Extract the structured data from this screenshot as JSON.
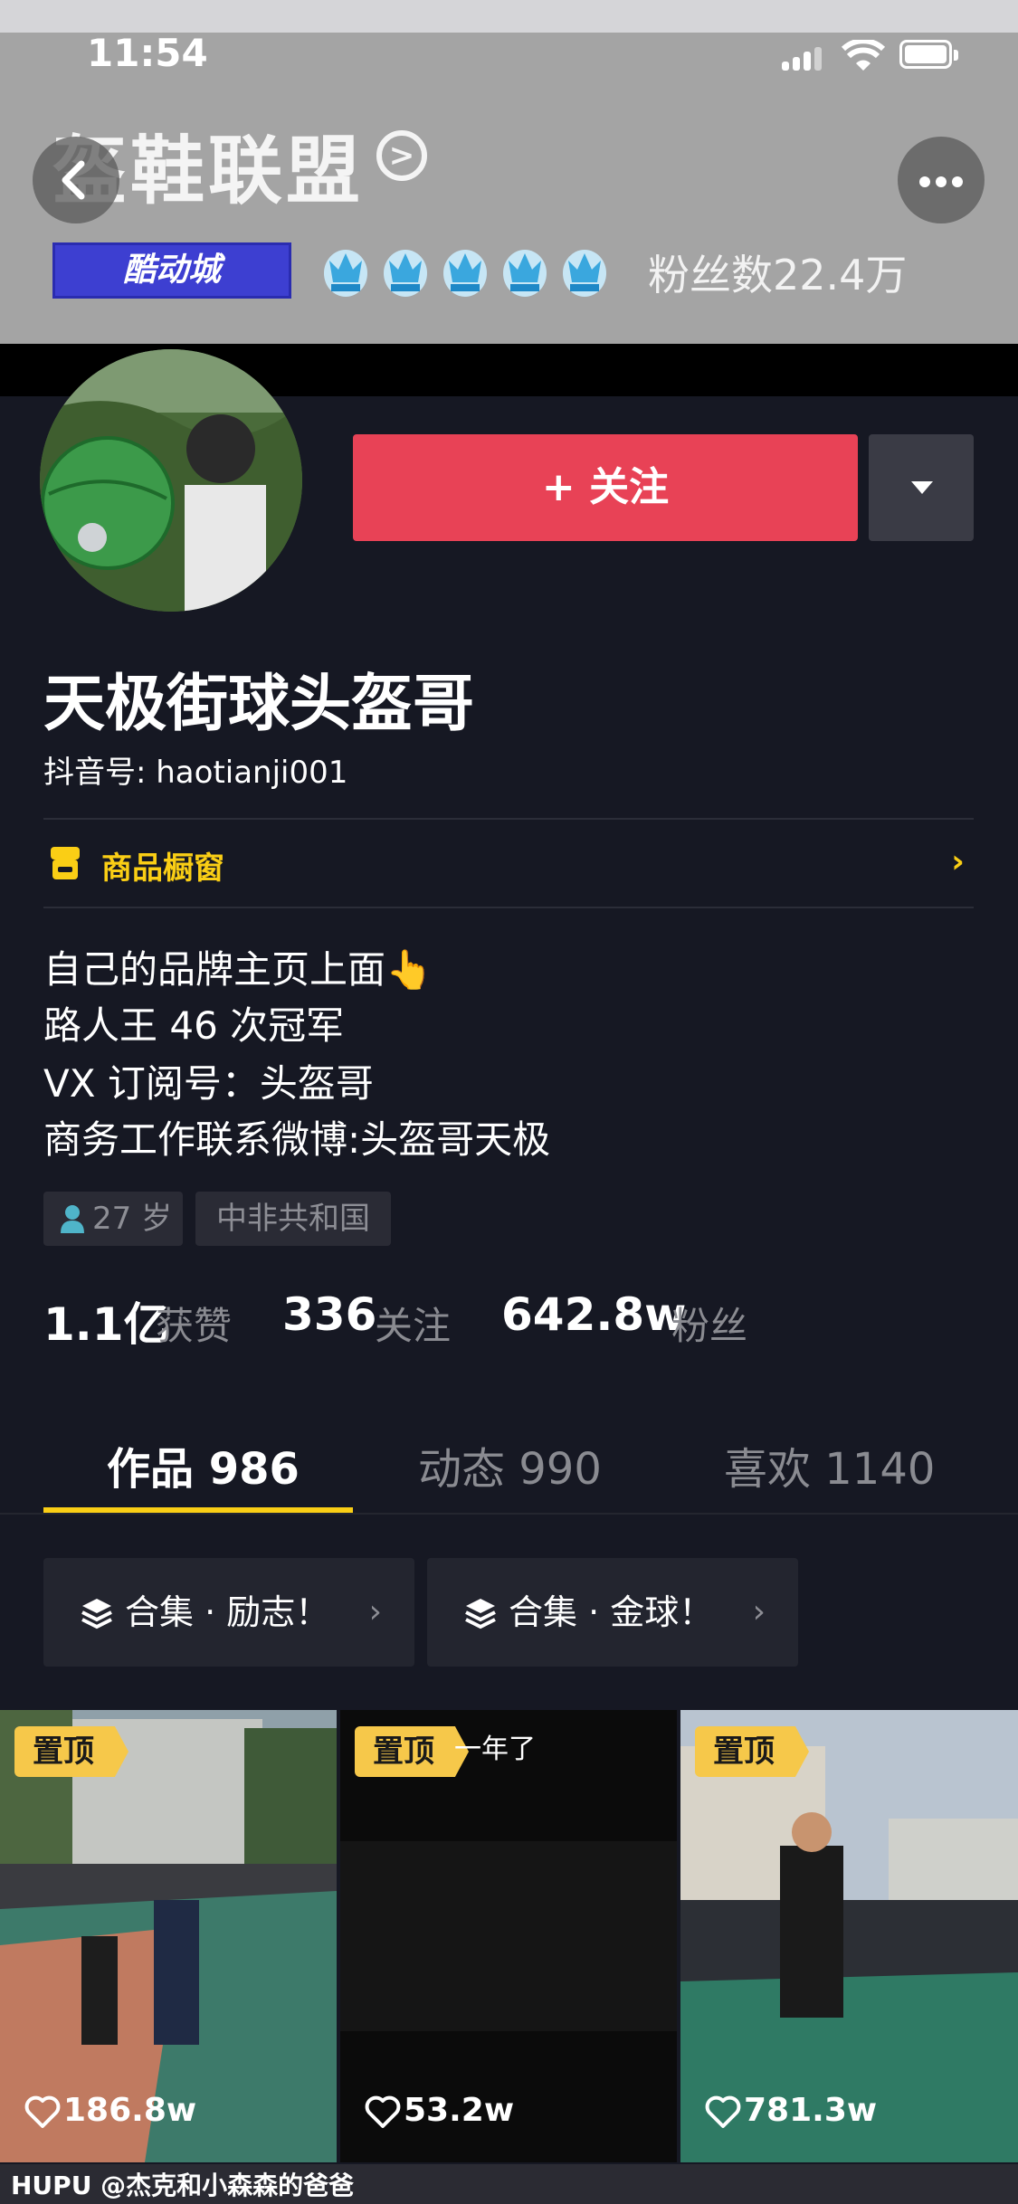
{
  "status_bar": {
    "time": "11:54"
  },
  "header": {
    "title": "盔鞋联盟",
    "brand_badge": "酷动城",
    "fans_text": "粉丝数22.4万"
  },
  "profile": {
    "follow_label": "+ 关注",
    "name": "天极街球头盔哥",
    "douyin_id": "抖音号: haotianji001",
    "shop_label": "商品橱窗",
    "bio": [
      "自己的品牌主页上面👆",
      "路人王 46 次冠军",
      "VX 订阅号：头盔哥",
      "商务工作联系微博:头盔哥天极"
    ],
    "tags": {
      "age": "27 岁",
      "location": "中非共和国"
    },
    "stats": [
      {
        "value": "1.1亿",
        "label": "获赞"
      },
      {
        "value": "336",
        "label": "关注"
      },
      {
        "value": "642.8w",
        "label": "粉丝"
      }
    ]
  },
  "tabs": [
    {
      "label": "作品 986",
      "active": true
    },
    {
      "label": "动态 990",
      "active": false
    },
    {
      "label": "喜欢 1140",
      "active": false
    }
  ],
  "collections": [
    {
      "label": "合集 · 励志！"
    },
    {
      "label": "合集 · 金球！"
    }
  ],
  "videos": [
    {
      "tag": "置顶",
      "caption": "",
      "likes": "186.8w"
    },
    {
      "tag": "置顶",
      "caption": "一年了",
      "likes": "53.2w"
    },
    {
      "tag": "置顶",
      "caption": "",
      "likes": "781.3w"
    }
  ],
  "watermark": "HUPU @杰克和小森森的爸爸",
  "colors": {
    "accent_red": "#e84256",
    "accent_yellow": "#face15",
    "background": "#161823"
  }
}
